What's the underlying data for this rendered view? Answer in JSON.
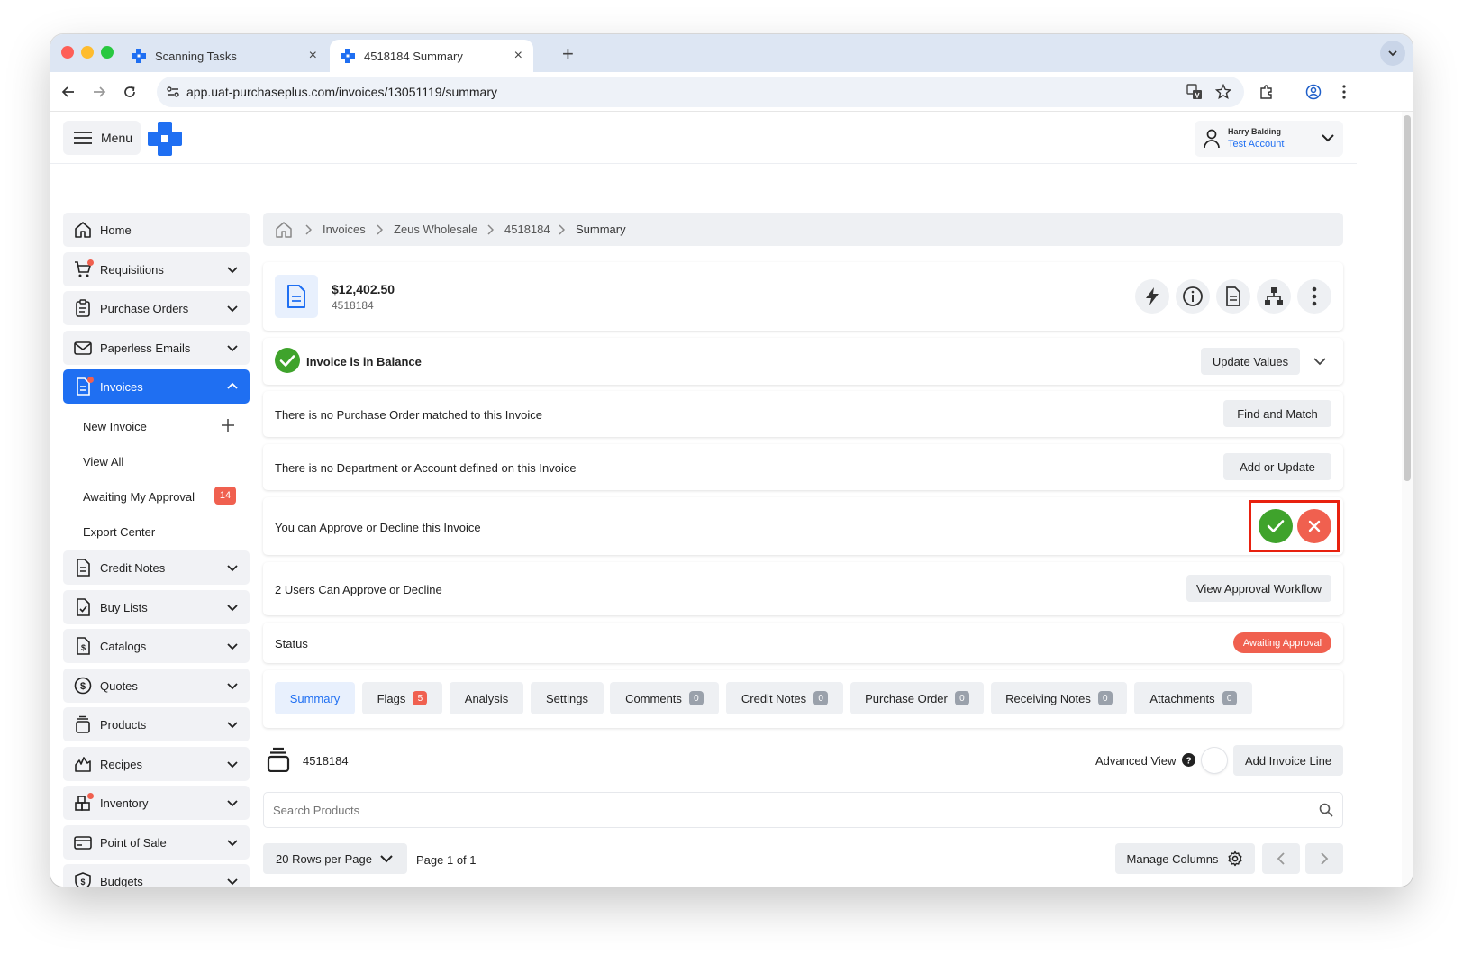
{
  "browser": {
    "tabs": [
      {
        "title": "Scanning Tasks"
      },
      {
        "title": "4518184 Summary"
      }
    ],
    "url": "app.uat-purchaseplus.com/invoices/13051119/summary"
  },
  "header": {
    "menu_label": "Menu",
    "user_name": "Harry Balding",
    "account": "Test Account"
  },
  "sidebar": {
    "items": [
      {
        "label": "Home"
      },
      {
        "label": "Requisitions"
      },
      {
        "label": "Purchase Orders"
      },
      {
        "label": "Paperless Emails"
      },
      {
        "label": "Invoices"
      },
      {
        "label": "Credit Notes"
      },
      {
        "label": "Buy Lists"
      },
      {
        "label": "Catalogs"
      },
      {
        "label": "Quotes"
      },
      {
        "label": "Products"
      },
      {
        "label": "Recipes"
      },
      {
        "label": "Inventory"
      },
      {
        "label": "Point of Sale"
      },
      {
        "label": "Budgets"
      }
    ],
    "invoice_subitems": [
      {
        "label": "New Invoice"
      },
      {
        "label": "View All"
      },
      {
        "label": "Awaiting My Approval",
        "badge": "14"
      },
      {
        "label": "Export Center"
      }
    ]
  },
  "breadcrumb": [
    "Invoices",
    "Zeus Wholesale",
    "4518184",
    "Summary"
  ],
  "invoice": {
    "amount": "$12,402.50",
    "number": "4518184"
  },
  "balance": {
    "text": "Invoice is in Balance",
    "button": "Update Values"
  },
  "rows": {
    "po_text": "There is no Purchase Order matched to this Invoice",
    "po_button": "Find and Match",
    "dept_text": "There is no Department or Account defined on this Invoice",
    "dept_button": "Add or Update",
    "approve_text": "You can Approve or Decline this Invoice",
    "users_text": "2 Users Can Approve or Decline",
    "users_button": "View Approval Workflow",
    "status_label": "Status",
    "status_badge": "Awaiting Approval"
  },
  "tabs": [
    {
      "label": "Summary"
    },
    {
      "label": "Flags",
      "count": "5"
    },
    {
      "label": "Analysis"
    },
    {
      "label": "Settings"
    },
    {
      "label": "Comments",
      "count": "0"
    },
    {
      "label": "Credit Notes",
      "count": "0"
    },
    {
      "label": "Purchase Order",
      "count": "0"
    },
    {
      "label": "Receiving Notes",
      "count": "0"
    },
    {
      "label": "Attachments",
      "count": "0"
    }
  ],
  "lines": {
    "invoice_number": "4518184",
    "advanced_view": "Advanced View",
    "add_line": "Add Invoice Line",
    "search_placeholder": "Search Products",
    "rows_per_page": "20 Rows per Page",
    "page_info": "Page 1 of 1",
    "manage_columns": "Manage Columns"
  },
  "colors": {
    "primary": "#1f6ff2",
    "success": "#3fa32c",
    "danger": "#f0604f",
    "highlight": "#e8210f"
  }
}
